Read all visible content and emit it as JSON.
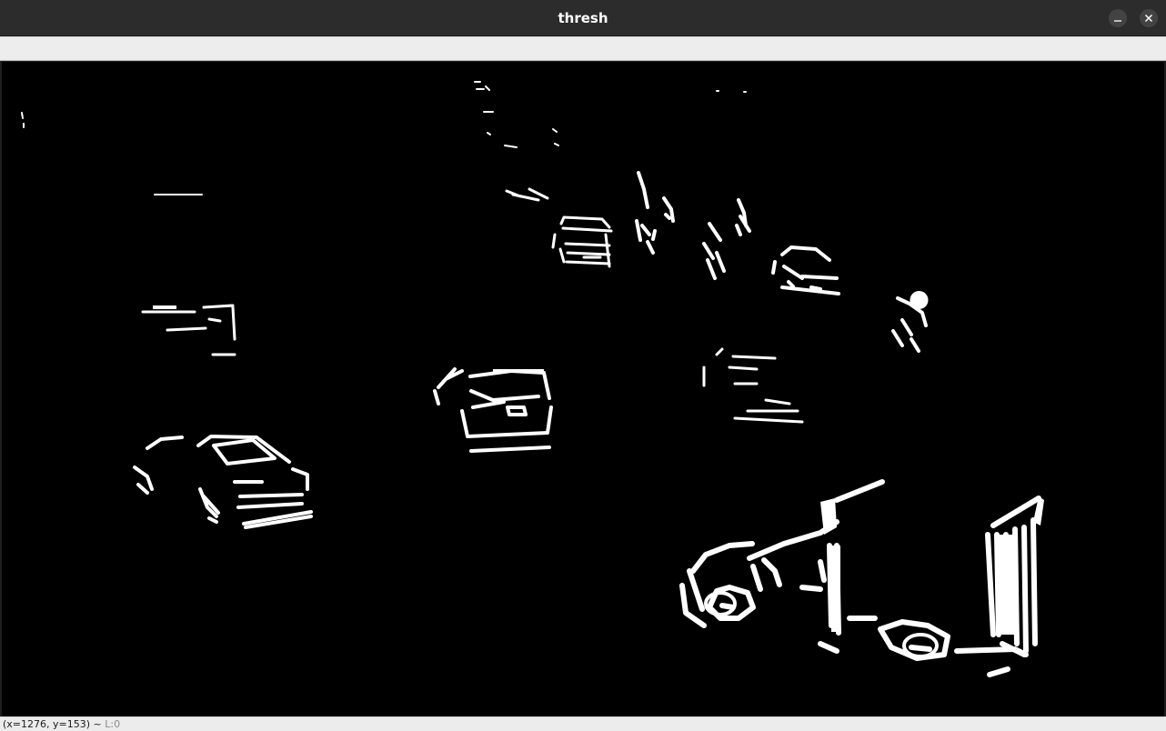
{
  "window": {
    "title": "thresh"
  },
  "image": {
    "description_icon": "binary-threshold-image",
    "background_color": "#000000",
    "foreground_color": "#ffffff"
  },
  "status": {
    "coords": "(x=1276, y=153) ~",
    "level": "L:0"
  },
  "colors": {
    "titlebar": "#2c2c2c",
    "toolbar": "#ededed",
    "statusbar": "#ececec"
  }
}
